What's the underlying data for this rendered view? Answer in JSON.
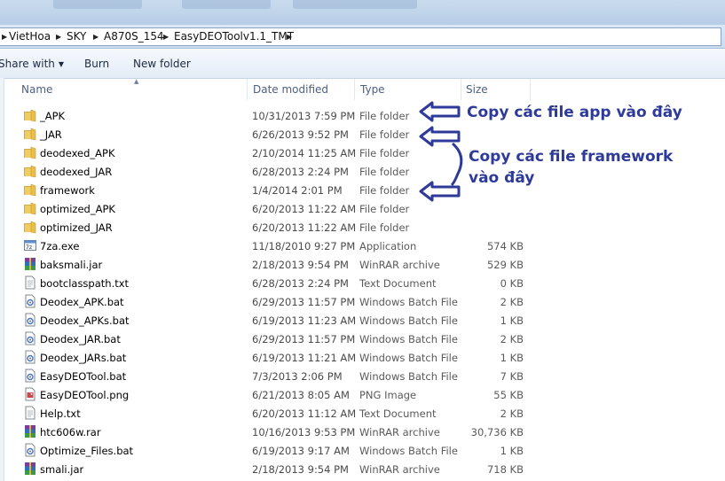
{
  "breadcrumb": [
    "VietHoa",
    "SKY",
    "A870S_154",
    "EasyDEOToolv1.1_TMT"
  ],
  "toolbar": {
    "share_with": "Share with",
    "burn": "Burn",
    "new_folder": "New folder"
  },
  "columns": {
    "name": "Name",
    "date": "Date modified",
    "type": "Type",
    "size": "Size"
  },
  "files": [
    {
      "name": "_APK",
      "date": "10/31/2013 7:59 PM",
      "type": "File folder",
      "size": "",
      "icon": "folder-icon"
    },
    {
      "name": "_JAR",
      "date": "6/26/2013 9:52 PM",
      "type": "File folder",
      "size": "",
      "icon": "folder-icon"
    },
    {
      "name": "deodexed_APK",
      "date": "2/10/2014 11:25 AM",
      "type": "File folder",
      "size": "",
      "icon": "folder-icon"
    },
    {
      "name": "deodexed_JAR",
      "date": "6/28/2013 2:24 PM",
      "type": "File folder",
      "size": "",
      "icon": "folder-icon"
    },
    {
      "name": "framework",
      "date": "1/4/2014 2:01 PM",
      "type": "File folder",
      "size": "",
      "icon": "folder-icon"
    },
    {
      "name": "optimized_APK",
      "date": "6/20/2013 11:22 AM",
      "type": "File folder",
      "size": "",
      "icon": "folder-icon"
    },
    {
      "name": "optimized_JAR",
      "date": "6/20/2013 11:22 AM",
      "type": "File folder",
      "size": "",
      "icon": "folder-icon"
    },
    {
      "name": "7za.exe",
      "date": "11/18/2010 9:27 PM",
      "type": "Application",
      "size": "574 KB",
      "icon": "exe-icon"
    },
    {
      "name": "baksmali.jar",
      "date": "2/18/2013 9:54 PM",
      "type": "WinRAR archive",
      "size": "529 KB",
      "icon": "winrar-icon"
    },
    {
      "name": "bootclasspath.txt",
      "date": "6/28/2013 2:24 PM",
      "type": "Text Document",
      "size": "0 KB",
      "icon": "text-file-icon"
    },
    {
      "name": "Deodex_APK.bat",
      "date": "6/29/2013 11:57 PM",
      "type": "Windows Batch File",
      "size": "2 KB",
      "icon": "batch-file-icon"
    },
    {
      "name": "Deodex_APKs.bat",
      "date": "6/19/2013 11:23 AM",
      "type": "Windows Batch File",
      "size": "1 KB",
      "icon": "batch-file-icon"
    },
    {
      "name": "Deodex_JAR.bat",
      "date": "6/29/2013 11:57 PM",
      "type": "Windows Batch File",
      "size": "2 KB",
      "icon": "batch-file-icon"
    },
    {
      "name": "Deodex_JARs.bat",
      "date": "6/19/2013 11:21 AM",
      "type": "Windows Batch File",
      "size": "1 KB",
      "icon": "batch-file-icon"
    },
    {
      "name": "EasyDEOTool.bat",
      "date": "7/3/2013 2:06 PM",
      "type": "Windows Batch File",
      "size": "7 KB",
      "icon": "batch-file-icon"
    },
    {
      "name": "EasyDEOTool.png",
      "date": "6/21/2013 8:05 AM",
      "type": "PNG Image",
      "size": "55 KB",
      "icon": "image-file-icon"
    },
    {
      "name": "Help.txt",
      "date": "6/20/2013 11:12 AM",
      "type": "Text Document",
      "size": "2 KB",
      "icon": "text-file-icon"
    },
    {
      "name": "htc606w.rar",
      "date": "10/16/2013 9:53 PM",
      "type": "WinRAR archive",
      "size": "30,736 KB",
      "icon": "winrar-icon"
    },
    {
      "name": "Optimize_Files.bat",
      "date": "6/19/2013 9:17 AM",
      "type": "Windows Batch File",
      "size": "1 KB",
      "icon": "batch-file-icon"
    },
    {
      "name": "smali.jar",
      "date": "2/18/2013 9:54 PM",
      "type": "WinRAR archive",
      "size": "718 KB",
      "icon": "winrar-icon"
    }
  ],
  "annotations": {
    "app": "Copy các file app vào đây",
    "framework_line1": "Copy các file framework",
    "framework_line2": "vào đây"
  },
  "colors": {
    "annotation": "#2e3a9a",
    "folder": "#e9c352"
  }
}
